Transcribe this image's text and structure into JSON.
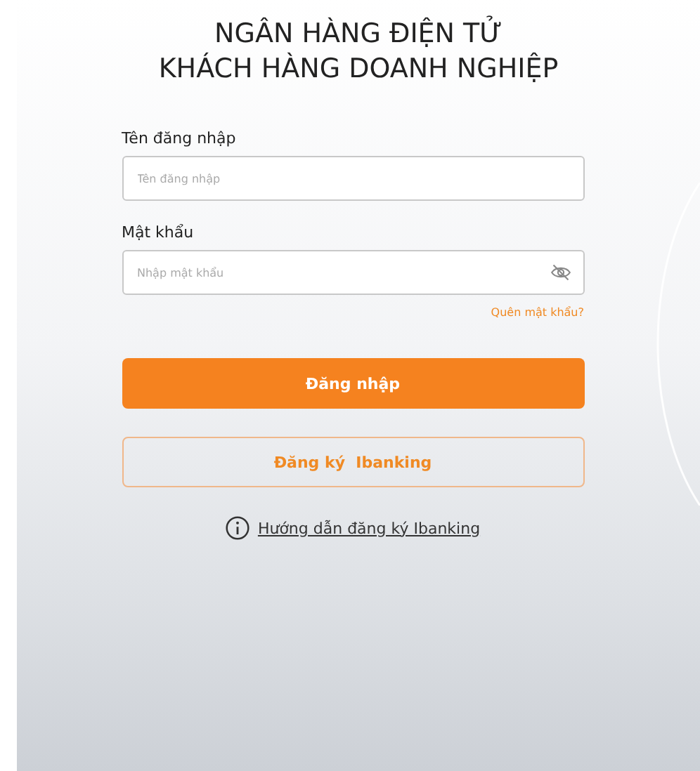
{
  "title_lines": [
    "NGÂN HÀNG ĐIỆN TỬ",
    "KHÁCH HÀNG DOANH NGHIỆP"
  ],
  "fields": [
    {
      "label": "Tên đăng nhập",
      "placeholder": "Tên đăng nhập",
      "kind": "text"
    },
    {
      "label": "Mật khẩu",
      "placeholder": "Nhập mật khẩu",
      "kind": "password"
    }
  ],
  "forgot_link": "Quên mật khẩu?",
  "login_button": "Đăng nhập",
  "register_button": "Đăng ký  Ibanking",
  "help_link": "Hướng dẫn đăng ký Ibanking"
}
